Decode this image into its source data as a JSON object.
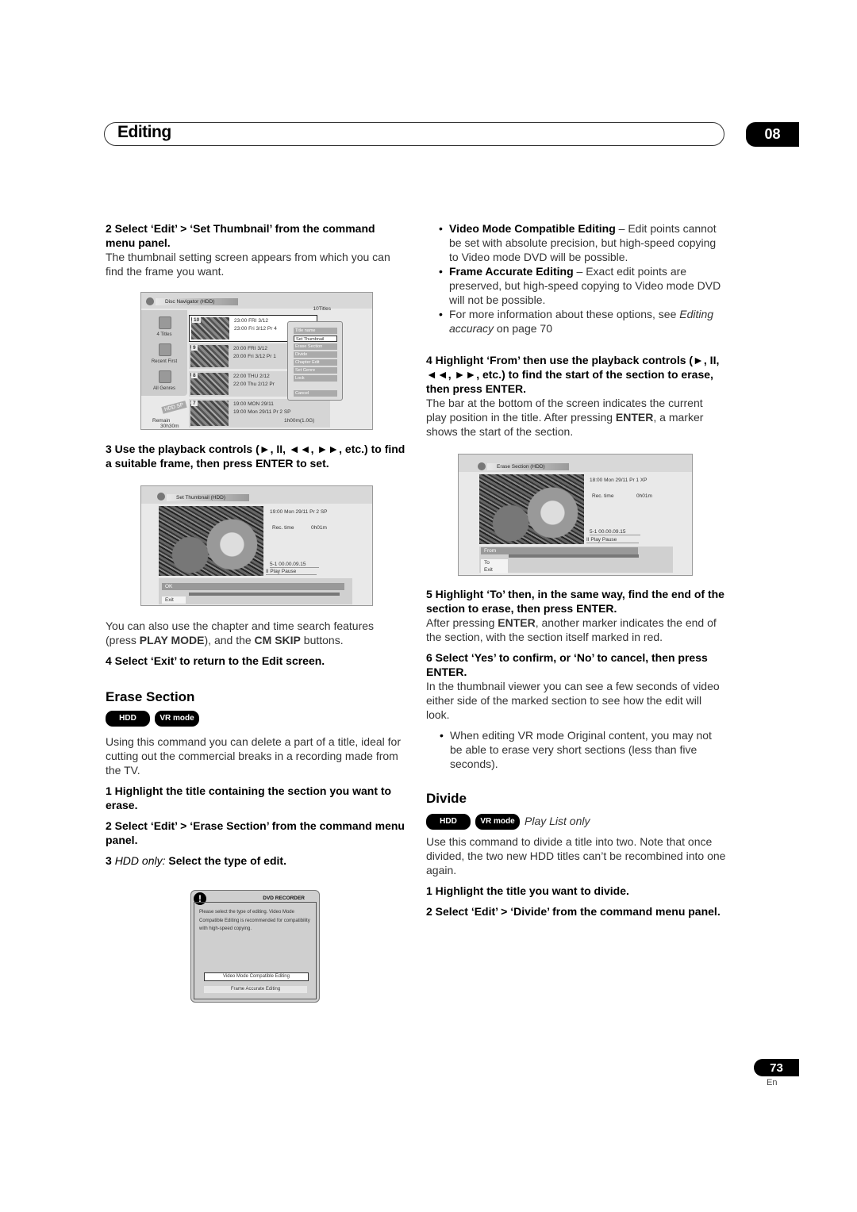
{
  "header": {
    "section_title": "Editing",
    "chapter": "08"
  },
  "left": {
    "step2_set_thumb": "2   Select ‘Edit’ > ‘Set Thumbnail’ from the command menu panel.",
    "step2_desc": "The thumbnail setting screen appears from which you can find the frame you want.",
    "step3_playback": "3   Use the playback controls (►, II, ◄◄, ►►, etc.) to find a suitable frame, then press ENTER to set.",
    "search_note_pre": "You can also use the chapter and time search features (press ",
    "search_note_play_mode": "PLAY MODE",
    "search_note_mid": "), and the ",
    "search_note_cm_skip": "CM SKIP",
    "search_note_post": " buttons.",
    "step4_exit": "4   Select ‘Exit’ to return to the Edit screen.",
    "erase_heading": "Erase Section",
    "erase_badges": [
      "HDD",
      "VR mode"
    ],
    "erase_desc": "Using this command you can delete a part of a title, ideal for cutting out the commercial breaks in a recording made from the TV.",
    "erase_step1": "1   Highlight the title containing the section you want to erase.",
    "erase_step2": "2   Select ‘Edit’ > ‘Erase Section’ from the command menu panel.",
    "erase_step3_num": "3   ",
    "erase_step3_italic": "HDD only: ",
    "erase_step3_text": "Select the type of edit."
  },
  "right": {
    "bullet1_bold": "Video Mode Compatible Editing",
    "bullet1_text": " – Edit points cannot be set with absolute precision, but high-speed copying to Video mode DVD will be possible.",
    "bullet2_bold": "Frame Accurate Editing",
    "bullet2_text": " – Exact edit points are preserved, but high-speed copying to Video mode DVD will not be possible.",
    "bullet3_text": "For more information about these options, see ",
    "bullet3_italic": "Editing accuracy",
    "bullet3_post": " on page 70",
    "step4_from": "4   Highlight ‘From’ then use the playback controls (►, II, ◄◄, ►►, etc.) to find the start of the section to erase, then press ENTER.",
    "step4_desc_pre": "The bar at the bottom of the screen indicates the current play position in the title. After pressing ",
    "step4_desc_enter": "ENTER",
    "step4_desc_post": ", a marker shows the start of the section.",
    "step5_to": "5   Highlight ‘To’ then, in the same way, find the end of the section to erase, then press ENTER.",
    "step5_desc_pre": "After pressing ",
    "step5_desc_enter": "ENTER",
    "step5_desc_post": ", another marker indicates the end of the section, with the section itself marked in red.",
    "step6_confirm": "6   Select ‘Yes’ to confirm, or ‘No’ to cancel, then press ENTER.",
    "step6_desc": "In the thumbnail viewer you can see a few seconds of video either side of the marked section to see how the edit will look.",
    "step6_bullet": "When editing VR mode Original content, you may not be able to erase very short sections (less than five seconds).",
    "divide_heading": "Divide",
    "divide_badges": [
      "HDD",
      "VR mode"
    ],
    "divide_badge_note": "Play List only",
    "divide_desc": "Use this command to divide a title into two. Note that once divided, the two new HDD titles can’t be recombined into one again.",
    "divide_step1": "1   Highlight the title you want to divide.",
    "divide_step2": "2   Select ‘Edit’ > ‘Divide’ from the command menu panel."
  },
  "screen_disc_nav": {
    "title": "Disc Navigator (HDD)",
    "count": "10Titles",
    "nav": [
      "4 Titles",
      "Recent First",
      "All Genres"
    ],
    "disk_label": "HDD SP",
    "remain_label": "Remain",
    "remain_value": "30h30m",
    "titles": [
      {
        "num": "10",
        "line1": "23:00 FRI  3/12",
        "line2": "23:00  Fri  3/12  Pr 4"
      },
      {
        "num": "9",
        "line1": "20:00  FRI  3/12",
        "line2": "20:00   Fri  3/12  Pr 1"
      },
      {
        "num": "8",
        "line1": "22:00  THU  2/12",
        "line2": "22:00   Thu  2/12  Pr"
      },
      {
        "num": "7",
        "line1": "19:00  MON  29/11",
        "line2": "19:00   Mon  29/11  Pr 2  SP"
      }
    ],
    "duration": "1h00m(1.0G)",
    "menu": [
      "Title name",
      "Set Thumbnail",
      "Erase Section",
      "Divide",
      "Chapter Edit",
      "Set Genre",
      "Lock",
      "Cancel"
    ],
    "menu_selected": "Set Thumbnail"
  },
  "screen_set_thumb": {
    "title": "Set Thumbnail  (HDD)",
    "info_line": "19:00  Mon  29/11  Pr 2   SP",
    "rec_time_label": "Rec. time",
    "rec_time_value": "0h01m",
    "position": "5-1     00.00.09.15",
    "status": "II Play Pause",
    "buttons": [
      "OK",
      "Exit"
    ]
  },
  "screen_erase": {
    "title": "Erase Section  (HDD)",
    "info_line": "18:00  Mon  29/11  Pr 1    XP",
    "rec_time_label": "Rec. time",
    "rec_time_value": "0h01m",
    "position": "5-1     00.00.09.15",
    "status": "II Play Pause",
    "buttons": [
      "From",
      "To",
      "Exit"
    ]
  },
  "dialog": {
    "brand": "DVD RECORDER",
    "message": "Please select the type of editing. Video Mode Compatible Editing is recommended for compatibility with high-speed copying.",
    "options": [
      "Video Mode Compatible Editing",
      "Frame Accurate Editing"
    ],
    "selected": "Video Mode Compatible Editing"
  },
  "footer": {
    "page": "73",
    "lang": "En"
  }
}
